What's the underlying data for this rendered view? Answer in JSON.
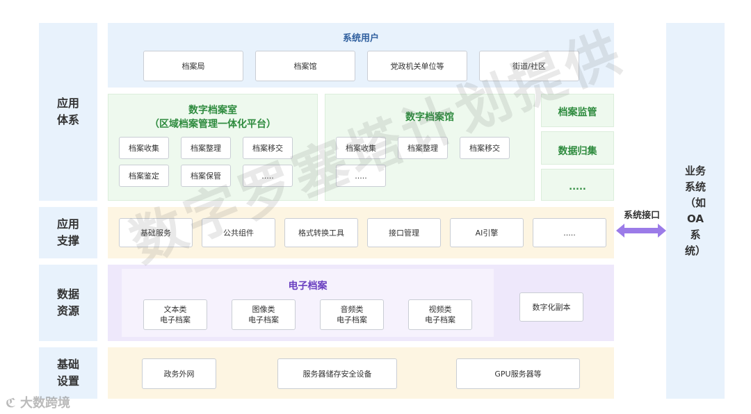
{
  "left_labels": {
    "app_system": [
      "应用",
      "体系"
    ],
    "app_support": [
      "应用",
      "支撑"
    ],
    "data_resource": [
      "数据",
      "资源"
    ],
    "infrastructure": [
      "基础",
      "设置"
    ]
  },
  "users": {
    "title": "系统用户",
    "items": [
      "档案局",
      "档案馆",
      "党政机关单位等",
      "街道/社区"
    ]
  },
  "archive_room": {
    "title_line1": "数字档案室",
    "title_line2": "（区域档案管理一体化平台）",
    "items": [
      "档案收集",
      "档案整理",
      "档案移交",
      "档案鉴定",
      "档案保管",
      "....."
    ]
  },
  "archive_museum": {
    "title": "数字档案馆",
    "items": [
      "档案收集",
      "档案整理",
      "档案移交",
      "....."
    ]
  },
  "side_stack": [
    "档案监管",
    "数据归集",
    "....."
  ],
  "support": {
    "items": [
      "基础服务",
      "公共组件",
      "格式转换工具",
      "接口管理",
      "AI引擎",
      "....."
    ]
  },
  "data": {
    "title": "电子档案",
    "items": [
      [
        "文本类",
        "电子档案"
      ],
      [
        "图像类",
        "电子档案"
      ],
      [
        "音频类",
        "电子档案"
      ],
      [
        "视频类",
        "电子档案"
      ]
    ],
    "copy": "数字化副本"
  },
  "infra": {
    "items": [
      "政务外网",
      "服务器储存安全设备",
      "GPU服务器等"
    ]
  },
  "interface_label": "系统接口",
  "oa": [
    "业务",
    "系统",
    "（如",
    "OA",
    "系",
    "统）"
  ],
  "watermark": "数字罗塞塔计划提供",
  "logo_text": "大数跨境",
  "colors": {
    "blue_panel": "#e8f2fc",
    "green_panel": "#eef9ee",
    "yellow_panel": "#fdf5e2",
    "purple_panel": "#eee8fb",
    "arrow": "#9b7be8"
  }
}
